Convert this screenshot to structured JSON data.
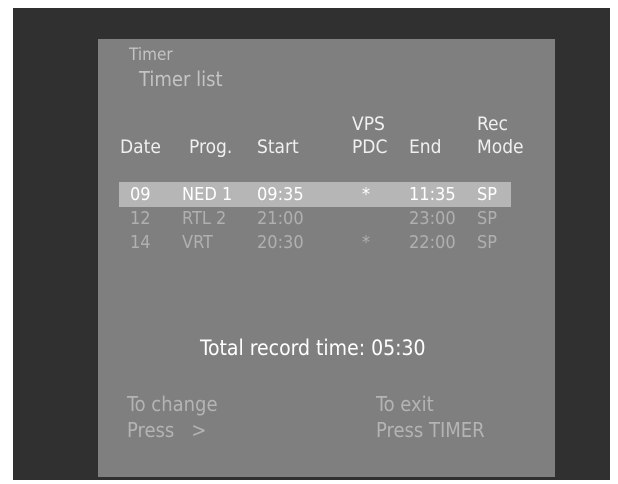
{
  "screen": {
    "title": "Timer",
    "subtitle": "Timer list"
  },
  "table": {
    "headers": {
      "date": "Date",
      "prog": "Prog.",
      "start": "Start",
      "vps_line1": "VPS",
      "vps_line2": "PDC",
      "end": "End",
      "rec_line1": "Rec",
      "rec_line2": "Mode"
    },
    "rows": [
      {
        "date": "09",
        "prog": "NED 1",
        "start": "09:35",
        "vps": "*",
        "end": "11:35",
        "mode": "SP",
        "selected": true
      },
      {
        "date": "12",
        "prog": "RTL 2",
        "start": "21:00",
        "vps": "",
        "end": "23:00",
        "mode": "SP",
        "selected": false
      },
      {
        "date": "14",
        "prog": "VRT",
        "start": "20:30",
        "vps": "*",
        "end": "22:00",
        "mode": "SP",
        "selected": false
      }
    ]
  },
  "summary": {
    "total_record_time": "Total record time: 05:30"
  },
  "hints": {
    "change_line1": "To change",
    "change_line2": "Press   >",
    "exit_line1": "To exit",
    "exit_line2": "Press TIMER"
  }
}
